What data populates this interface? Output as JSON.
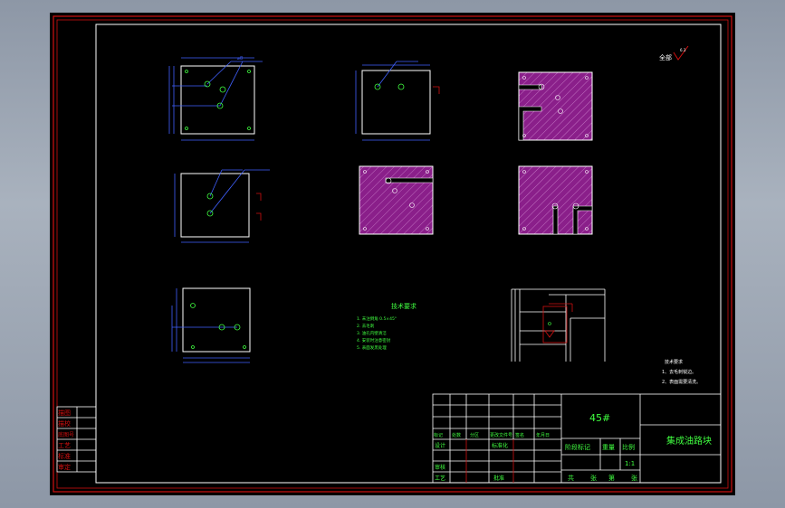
{
  "drawing": {
    "roughness_symbol_label": "全部",
    "roughness_value": "6.3",
    "tech_requirements": {
      "title": "技术要求",
      "items": [
        "1.  未注倒角 0.5×45°",
        "2.  去毛刺",
        "3.  油孔内壁清洁",
        "4.  安装时注意密封",
        "5.  表面发黑处理"
      ]
    },
    "detail_note": {
      "title": "技术要求",
      "items": [
        "1、去毛刺锐边。",
        "2、表面需要清洗。"
      ]
    },
    "left_strip": [
      "描图",
      "描校",
      "底图号",
      "工艺",
      "标准",
      "审定"
    ],
    "title_block": {
      "material": "45#",
      "part_name": "集成油路块",
      "header_row": [
        "标记",
        "处数",
        "分区",
        "更改文件号",
        "签名",
        "年月日"
      ],
      "design_row": [
        "设计",
        "",
        "标准化"
      ],
      "review_label": "审核",
      "process_label": "工艺",
      "approve_label": "批准",
      "stage_labels": [
        "阶段标记",
        "重量",
        "比例"
      ],
      "scale": "1:1",
      "sheet_labels": [
        "共",
        "张",
        "第",
        "张"
      ]
    }
  }
}
